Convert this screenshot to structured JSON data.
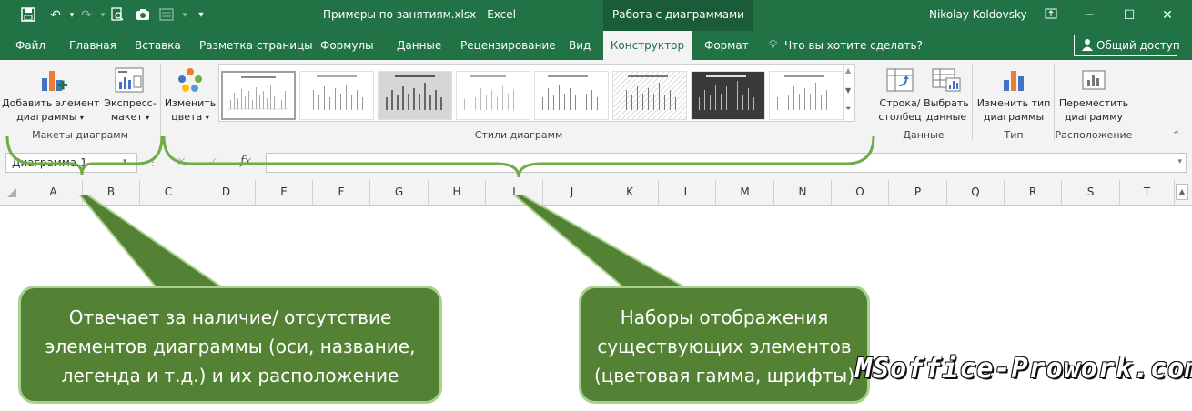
{
  "titlebar": {
    "file_title": "Примеры по занятиям.xlsx - Excel",
    "context_tab": "Работа с диаграммами",
    "user": "Nikolay Koldovsky",
    "accent": "#217346"
  },
  "tabs": [
    "Файл",
    "Главная",
    "Вставка",
    "Разметка страницы",
    "Формулы",
    "Данные",
    "Рецензирование",
    "Вид",
    "Конструктор",
    "Формат"
  ],
  "tell_me": "Что вы хотите сделать?",
  "share": "Общий доступ",
  "ribbon": {
    "add_element": [
      "Добавить элемент",
      "диаграммы"
    ],
    "quick_layout": [
      "Экспресс-",
      "макет"
    ],
    "change_colors": [
      "Изменить",
      "цвета"
    ],
    "switch_rowcol": [
      "Строка/",
      "столбец"
    ],
    "select_data": [
      "Выбрать",
      "данные"
    ],
    "change_type": [
      "Изменить тип",
      "диаграммы"
    ],
    "move_chart": [
      "Переместить",
      "диаграмму"
    ],
    "groups": {
      "layouts": "Макеты диаграмм",
      "styles": "Стили диаграмм",
      "data": "Данные",
      "type": "Тип",
      "location": "Расположение"
    }
  },
  "formula_bar": {
    "name_box": "Диаграмма 1",
    "fx": "fx"
  },
  "columns": [
    "A",
    "B",
    "C",
    "D",
    "E",
    "F",
    "G",
    "H",
    "I",
    "J",
    "K",
    "L",
    "M",
    "N",
    "O",
    "P",
    "Q",
    "R",
    "S",
    "T"
  ],
  "callouts": {
    "left": [
      "Отвечает за наличие/ отсутствие",
      "элементов диаграммы (оси, название,",
      "легенда и т.д.) и их расположение"
    ],
    "right": [
      "Наборы отображения",
      "существующих элементов",
      "(цветовая гамма, шрифты)"
    ]
  },
  "watermark": "MSoffice-Prowork.com",
  "colors": {
    "callout_fill": "#548235",
    "callout_border": "#a9d18e",
    "bracket": "#70ad47"
  }
}
